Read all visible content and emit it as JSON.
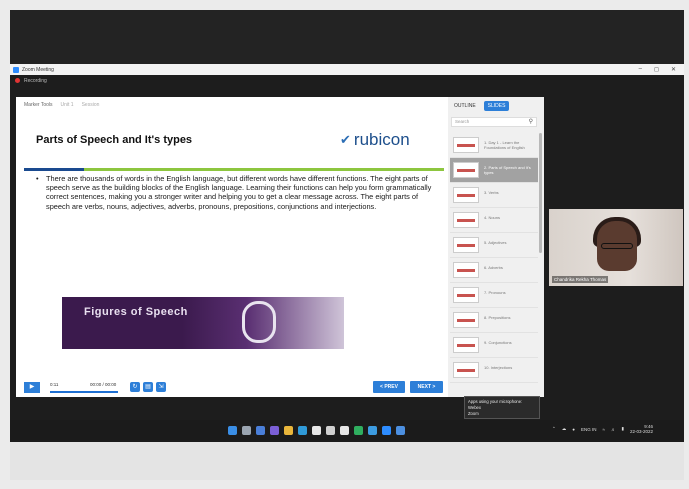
{
  "window": {
    "title": "Zoom Meeting",
    "recording": "Recording",
    "controls": [
      "–",
      "◻",
      "✕"
    ]
  },
  "breadcrumb": [
    "Marker Tools",
    "Unit 1",
    "Session"
  ],
  "slide": {
    "title": "Parts of Speech and It's types",
    "logo": "rubicon",
    "body": "There are thousands of words in the English language, but different words have different functions. The eight parts of speech serve as the building blocks of the English language. Learning their functions can help you form grammatically correct sentences, making you a stronger writer and helping you to get a clear message across. The eight parts of speech are verbs, nouns, adjectives, adverbs, pronouns, prepositions, conjunctions and interjections.",
    "figure_text": "Figures of Speech"
  },
  "player": {
    "current_time": "0:11",
    "total_time": "00:00 / 00:00",
    "prev_label": "< PREV",
    "next_label": "NEXT >"
  },
  "side_panel": {
    "tabs": [
      "OUTLINE",
      "SLIDES"
    ],
    "search_placeholder": "Search",
    "thumbs": [
      "1. Day 1 - Learn the Foundations of English",
      "2. Parts of Speech and It's types",
      "3. Verbs",
      "4. Nouns",
      "5. Adjectives",
      "6. Adverbs",
      "7. Pronouns",
      "8. Prepositions",
      "9. Conjunctions",
      "10. Interjections"
    ]
  },
  "video": {
    "name": "Chandrika Rekha Thomas"
  },
  "tooltip": {
    "lines": [
      "Apps using your microphone:",
      "Webex",
      "Zoom"
    ]
  },
  "tray": {
    "lang": "ENG\nIN",
    "time": "9:46",
    "date": "22-03-2022"
  },
  "colors": {
    "accent": "#2d7fd8",
    "logo": "#1d4f8c",
    "divider_green": "#8dc63f",
    "divider_blue": "#1a4a8f"
  }
}
